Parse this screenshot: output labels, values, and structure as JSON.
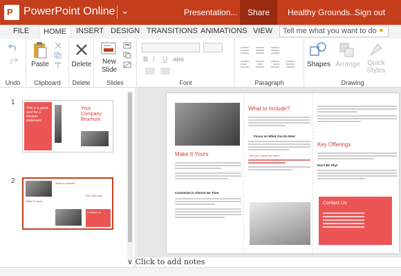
{
  "titlebar": {
    "app_name": "PowerPoint Online",
    "document_name": "Presentation...",
    "share_label": "Share",
    "site_name": "Healthy Grounds...",
    "sign_out_label": "Sign out",
    "app_badge": "P",
    "chevron": "⌄"
  },
  "tabs": {
    "items": [
      "FILE",
      "HOME",
      "INSERT",
      "DESIGN",
      "TRANSITIONS",
      "ANIMATIONS",
      "VIEW"
    ],
    "active": "HOME",
    "tell_me_placeholder": "Tell me what you want to do"
  },
  "ribbon": {
    "undo": {
      "label": "Undo"
    },
    "clipboard": {
      "paste": "Paste",
      "label": "Clipboard"
    },
    "delete": {
      "button": "Delete",
      "label": "Delete"
    },
    "slides": {
      "new_slide_line1": "New",
      "new_slide_line2": "Slide",
      "label": "Slides"
    },
    "font": {
      "label": "Font",
      "bold": "B",
      "italic": "I",
      "underline": "U",
      "strike": "abc"
    },
    "paragraph": {
      "label": "Paragraph"
    },
    "drawing": {
      "label": "Drawing",
      "shapes": "Shapes",
      "arrange": "Arrange",
      "quick_styles_1": "Quick",
      "quick_styles_2": "Styles"
    }
  },
  "slide_panel": {
    "slides": [
      {
        "number": "1",
        "lead": "This is a great spot for a mission statement",
        "title1": "Your",
        "title2": "Company",
        "title3": "Brochure"
      },
      {
        "number": "2",
        "heading_a": "What to Include?",
        "heading_b": "Make It Yours",
        "heading_c": "Key Offerings",
        "heading_d": "Contact Us"
      }
    ]
  },
  "slide": {
    "col1": {
      "heading": "Make It Yours",
      "sub": "Customize in Almost No Time"
    },
    "col2": {
      "heading": "What to Include?",
      "sub": "Focus on What You Do Best",
      "quote": "\"Get your name out there!\""
    },
    "col3": {
      "heading": "Key Offerings",
      "sub": "Don't Be Shy!",
      "contact": "Contact Us"
    }
  },
  "notes": {
    "placeholder": "Click to add notes",
    "toggle_icon": "∨"
  },
  "colors": {
    "brand": "#c43e1c",
    "accent": "#ec5555"
  }
}
